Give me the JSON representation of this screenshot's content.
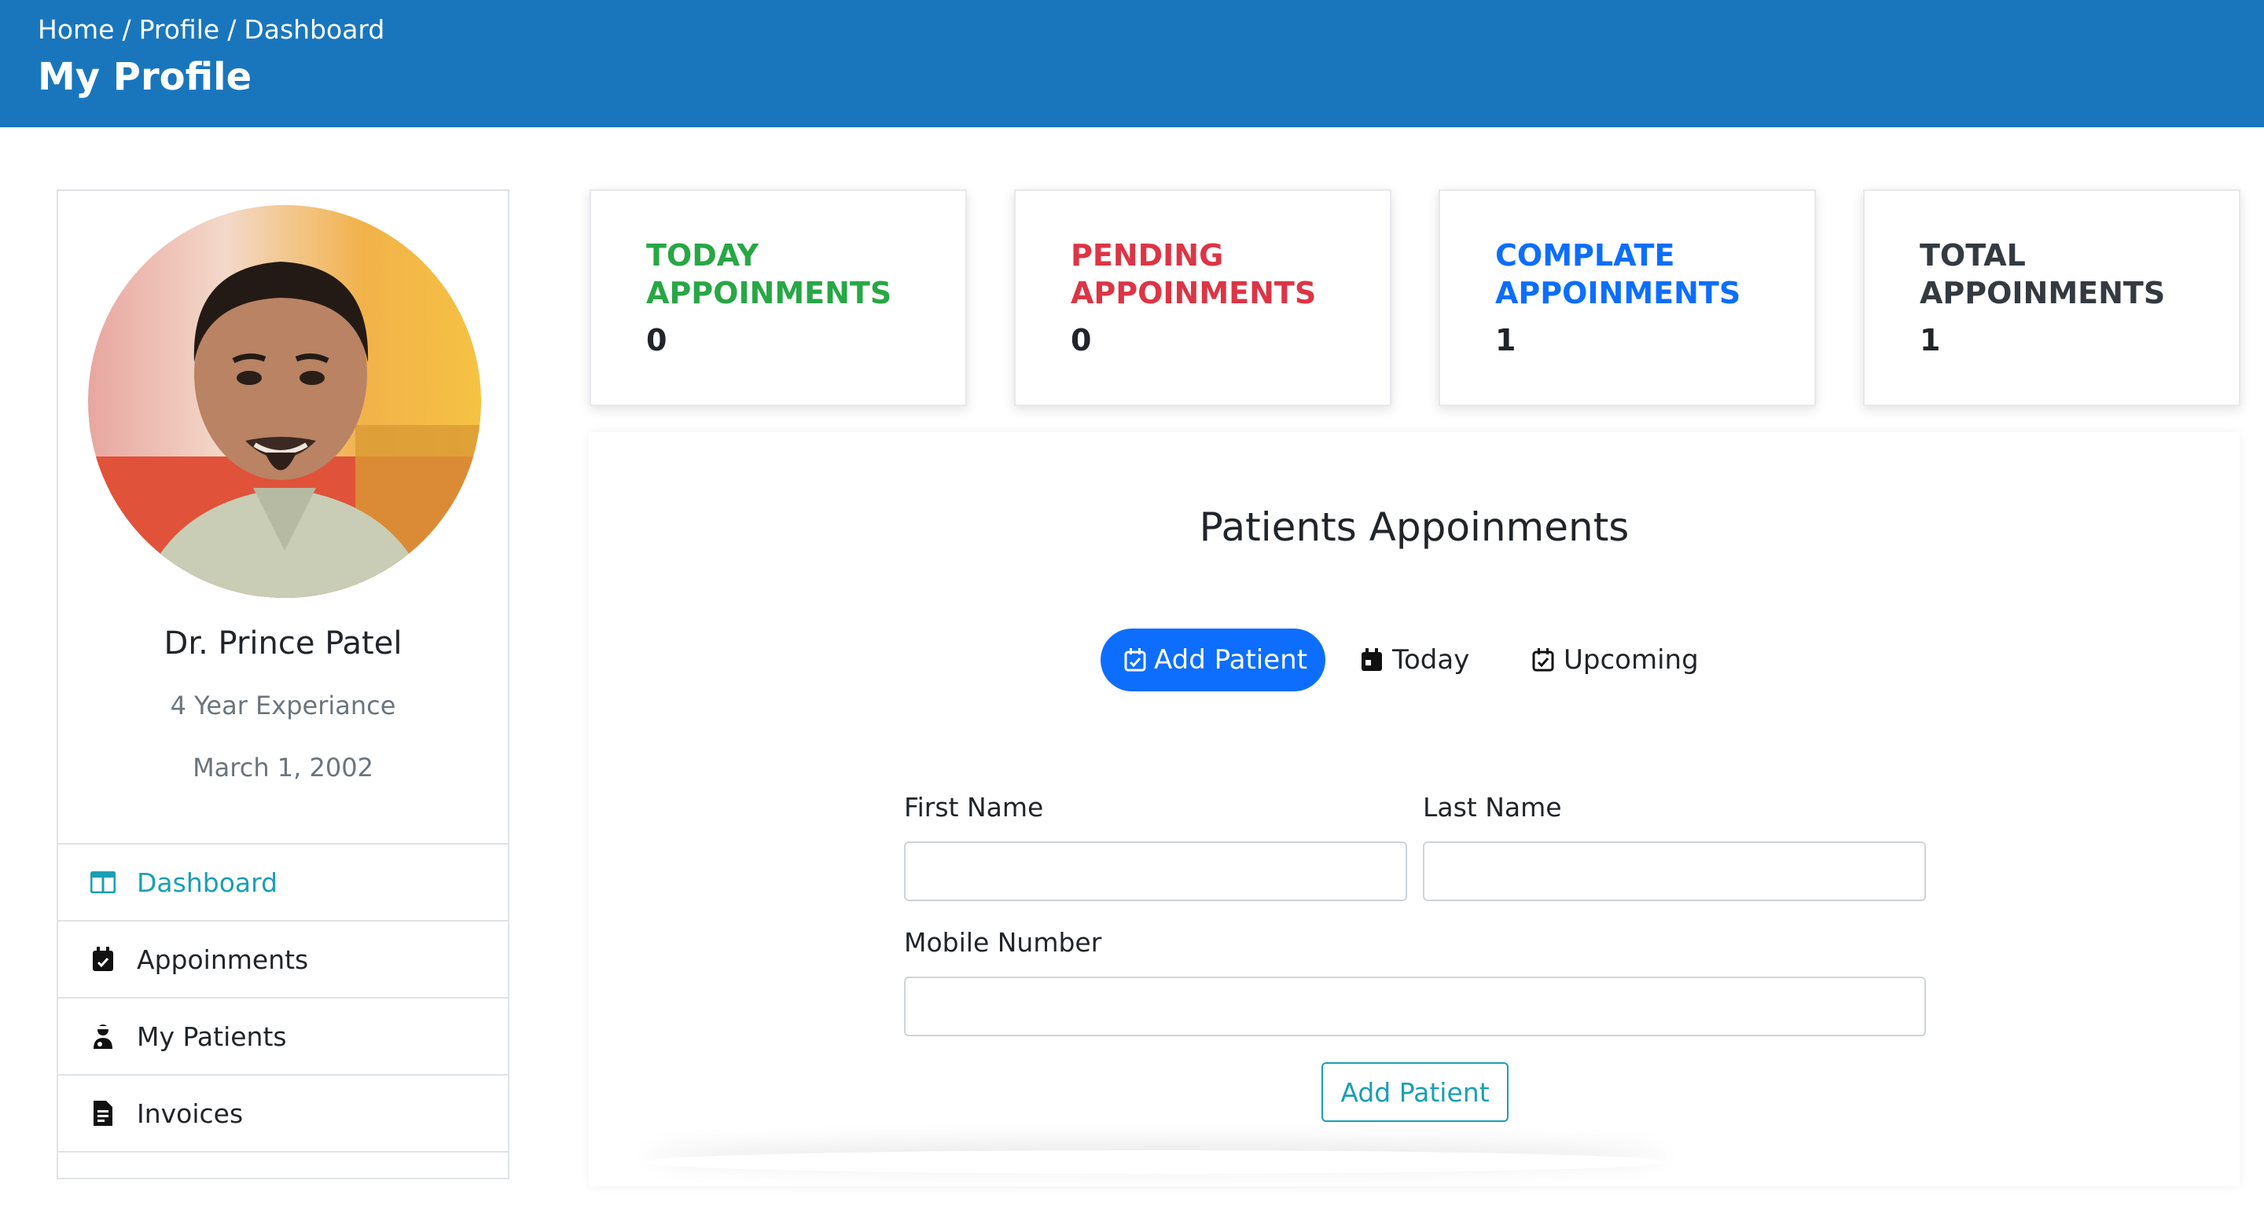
{
  "header": {
    "breadcrumb": [
      "Home",
      "Profile",
      "Dashboard"
    ],
    "separator": "/",
    "title": "My Profile",
    "background": "#1976bd"
  },
  "profile": {
    "name": "Dr. Prince Patel",
    "experience": "4 Year Experiance",
    "date": "March 1, 2002"
  },
  "menu": {
    "items": [
      {
        "label": "Dashboard",
        "icon": "columns-icon",
        "active": true
      },
      {
        "label": "Appoinments",
        "icon": "calendar-check-icon"
      },
      {
        "label": "My Patients",
        "icon": "user-injured-icon"
      },
      {
        "label": "Invoices",
        "icon": "file-invoice-icon"
      }
    ],
    "active_color": "#1a9fb4"
  },
  "stats": [
    {
      "label": "TODAY APPOINMENTS",
      "value": "0",
      "color": "#28a745"
    },
    {
      "label": "PENDING APPOINMENTS",
      "value": "0",
      "color": "#dc3545"
    },
    {
      "label": "COMPLATE APPOINMENTS",
      "value": "1",
      "color": "#0d6efd"
    },
    {
      "label": "TOTAL APPOINMENTS",
      "value": "1",
      "color": "#343a40"
    }
  ],
  "patients": {
    "title": "Patients Appoinments",
    "tabs": [
      {
        "label": "Add Patient",
        "icon": "calendar-check-icon",
        "active": true
      },
      {
        "label": "Today",
        "icon": "calendar-day-icon"
      },
      {
        "label": "Upcoming",
        "icon": "calendar-check-icon"
      }
    ],
    "form": {
      "first_name_label": "First Name",
      "first_name_value": "",
      "last_name_label": "Last Name",
      "last_name_value": "",
      "mobile_label": "Mobile Number",
      "mobile_value": "",
      "submit_label": "Add Patient"
    }
  }
}
